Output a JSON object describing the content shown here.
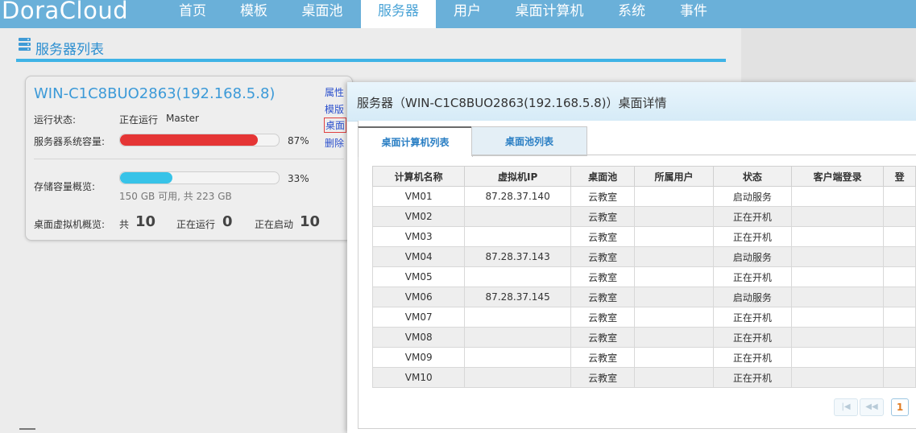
{
  "app": {
    "logo": "DoraCloud"
  },
  "nav": {
    "items": [
      {
        "label": "首页",
        "active": false
      },
      {
        "label": "模板",
        "active": false
      },
      {
        "label": "桌面池",
        "active": false
      },
      {
        "label": "服务器",
        "active": true
      },
      {
        "label": "用户",
        "active": false
      },
      {
        "label": "桌面计算机",
        "active": false
      },
      {
        "label": "系统",
        "active": false
      },
      {
        "label": "事件",
        "active": false
      }
    ]
  },
  "section": {
    "title": "服务器列表",
    "icon": "server-list-icon"
  },
  "server": {
    "name": "WIN-C1C8BUO2863(192.168.5.8)",
    "run_status_label": "运行状态:",
    "run_status_value": "正在运行",
    "role": "Master",
    "sys_capacity_label": "服务器系统容量:",
    "sys_capacity_percent": 87,
    "sys_capacity_text": "87%",
    "storage_label": "存储容量概览:",
    "storage_percent": 33,
    "storage_text": "33%",
    "storage_detail": "150 GB 可用, 共 223 GB",
    "vm_label": "桌面虚拟机概览:",
    "vm_total_label": "共",
    "vm_total": "10",
    "vm_running_label": "正在运行",
    "vm_running": "0",
    "vm_starting_label": "正在启动",
    "vm_starting": "10",
    "actions": [
      "属性",
      "模版",
      "桌面",
      "删除"
    ]
  },
  "dialog": {
    "title": "服务器（WIN-C1C8BUO2863(192.168.5.8)）桌面详情",
    "tabs": [
      "桌面计算机列表",
      "桌面池列表"
    ],
    "columns": [
      "计算机名称",
      "虚拟机IP",
      "桌面池",
      "所属用户",
      "状态",
      "客户端登录",
      "登"
    ],
    "rows": [
      {
        "name": "VM01",
        "ip": "87.28.37.140",
        "pool": "云教室",
        "user": "",
        "status": "启动服务",
        "client": ""
      },
      {
        "name": "VM02",
        "ip": "",
        "pool": "云教室",
        "user": "",
        "status": "正在开机",
        "client": ""
      },
      {
        "name": "VM03",
        "ip": "",
        "pool": "云教室",
        "user": "",
        "status": "正在开机",
        "client": ""
      },
      {
        "name": "VM04",
        "ip": "87.28.37.143",
        "pool": "云教室",
        "user": "",
        "status": "启动服务",
        "client": ""
      },
      {
        "name": "VM05",
        "ip": "",
        "pool": "云教室",
        "user": "",
        "status": "正在开机",
        "client": ""
      },
      {
        "name": "VM06",
        "ip": "87.28.37.145",
        "pool": "云教室",
        "user": "",
        "status": "启动服务",
        "client": ""
      },
      {
        "name": "VM07",
        "ip": "",
        "pool": "云教室",
        "user": "",
        "status": "正在开机",
        "client": ""
      },
      {
        "name": "VM08",
        "ip": "",
        "pool": "云教室",
        "user": "",
        "status": "正在开机",
        "client": ""
      },
      {
        "name": "VM09",
        "ip": "",
        "pool": "云教室",
        "user": "",
        "status": "正在开机",
        "client": ""
      },
      {
        "name": "VM10",
        "ip": "",
        "pool": "云教室",
        "user": "",
        "status": "正在开机",
        "client": ""
      }
    ],
    "pager": {
      "first": "|◀",
      "prev": "◀◀",
      "current": "1"
    }
  },
  "colors": {
    "nav_bg": "#6ab0d9",
    "accent": "#3fb3e6",
    "sys_bar": "#e53535",
    "storage_bar": "#37c3e8",
    "status_green": "#2e8b2e"
  }
}
